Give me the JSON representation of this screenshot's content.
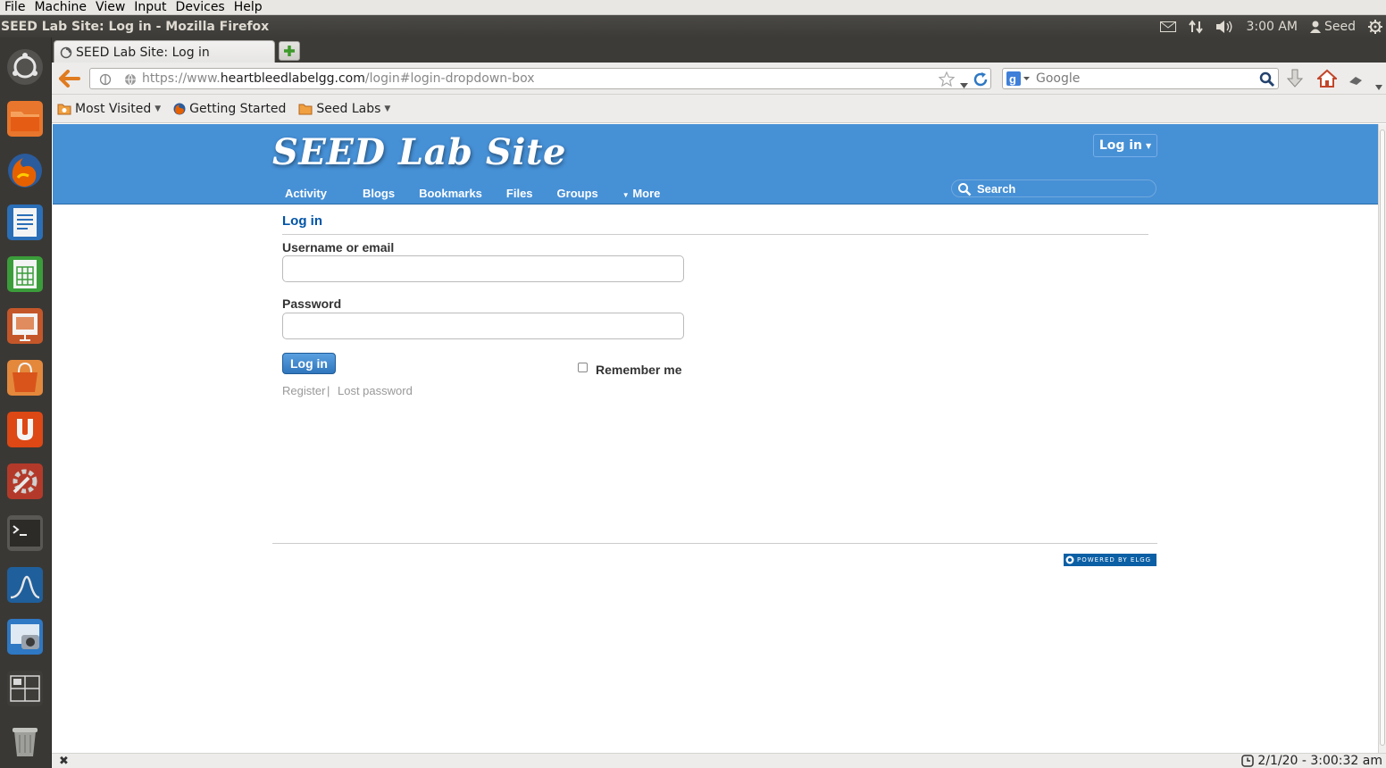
{
  "vm_menu": [
    "File",
    "Machine",
    "View",
    "Input",
    "Devices",
    "Help"
  ],
  "window": {
    "title": "SEED Lab Site: Log in - Mozilla Firefox"
  },
  "panel": {
    "time": "3:00 AM",
    "user": "Seed"
  },
  "browser": {
    "tab_title": "SEED Lab Site: Log in",
    "url_prefix": "https://www.",
    "url_host": "heartbleedlabelgg.com",
    "url_path": "/login#login-dropdown-box",
    "search_placeholder": "Google",
    "bookmarks": [
      "Most Visited",
      "Getting Started",
      "Seed Labs"
    ]
  },
  "site": {
    "title": "SEED Lab Site",
    "login_dropdown": "Log in",
    "nav": [
      "Activity",
      "Blogs",
      "Bookmarks",
      "Files",
      "Groups",
      "More"
    ],
    "search_placeholder": "Search"
  },
  "login_form": {
    "heading": "Log in",
    "username_label": "Username or email",
    "password_label": "Password",
    "submit_label": "Log in",
    "remember_label": "Remember me",
    "register_link": "Register",
    "separator": "|",
    "lost_password_link": "Lost password"
  },
  "footer": {
    "powered_by": "POWERED BY ELGG"
  },
  "status_bar": {
    "clock": "2/1/20 - 3:00:32 am"
  },
  "colors": {
    "header_blue": "#4690d6",
    "link_blue": "#0054a7"
  }
}
